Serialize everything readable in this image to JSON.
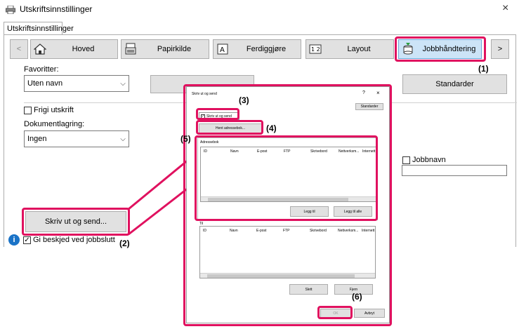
{
  "window": {
    "title": "Utskriftsinnstillinger",
    "tab": "Utskriftsinnstillinger",
    "close": "×"
  },
  "nav": {
    "prev": "<",
    "next": ">",
    "items": [
      {
        "label": "Hoved",
        "icon": "house-icon"
      },
      {
        "label": "Papirkilde",
        "icon": "printer-tray-icon"
      },
      {
        "label": "Ferdiggjøre",
        "icon": "finishing-icon"
      },
      {
        "label": "Layout",
        "icon": "layout-icon"
      },
      {
        "label": "Jobbhåndtering",
        "icon": "job-handling-icon"
      }
    ]
  },
  "left": {
    "favorites_label": "Favoritter:",
    "favorites_value": "Uten navn",
    "release_print": "Frigi utskrift",
    "doc_storage_label": "Dokumentlagring:",
    "doc_storage_value": "Ingen",
    "print_send_button": "Skriv ut og send...",
    "notify_label": "Gi beskjed ved jobbslutt"
  },
  "right": {
    "defaults_button": "Standarder",
    "jobname_label": "Jobbnavn"
  },
  "dialog": {
    "title": "Skriv ut og send",
    "help": "?",
    "close": "×",
    "defaults_button": "Standarder",
    "print_send_checkbox": "Skriv ut og send",
    "address_book_button": "Hent adressebok...",
    "address_book_label": "Adressebok",
    "columns": [
      "ID",
      "Navn",
      "E-post",
      "FTP",
      "Skrivebord",
      "Nettverksm...",
      "Internett"
    ],
    "add_button": "Legg til",
    "add_all_button": "Legg til alle",
    "to_label": "Til",
    "delete_button": "Slett",
    "remove_button": "Fjern",
    "ok_button": "OK",
    "cancel_button": "Avbryt"
  },
  "callouts": {
    "c1": "(1)",
    "c2": "(2)",
    "c3": "(3)",
    "c4": "(4)",
    "c5": "(5)",
    "c6": "(6)"
  },
  "colors": {
    "highlight": "#e0115f",
    "button_face": "#e1e1e1",
    "selected_tab": "#cce4f7",
    "info_icon": "#1a73c7"
  }
}
